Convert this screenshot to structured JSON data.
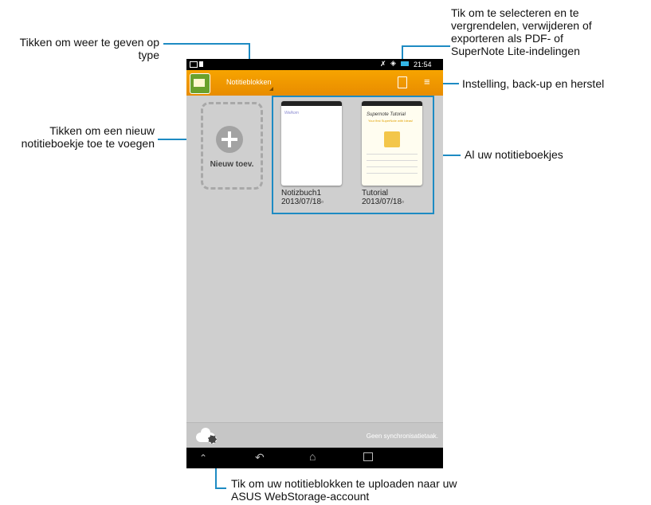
{
  "callouts": {
    "type_toggle": "Tikken om weer te geven op type",
    "select_lock": "Tik om te selecteren en te vergrendelen, verwijderen of exporteren als PDF- of SuperNote Lite-indelingen",
    "settings": "Instelling, back-up en herstel",
    "add_notebook": "Tikken om een nieuw notitieboekje toe te voegen",
    "all_notebooks": "Al uw notitieboekjes",
    "upload": "Tik om uw notitieblokken te uploaden naar uw ASUS WebStorage-account"
  },
  "device": {
    "status_time": "21:54",
    "actionbar_title": "Notitieblokken",
    "add_label": "Nieuw toev.",
    "sync_status": "Geen synchronisatietaak.",
    "notebooks": [
      {
        "name": "Notizbuch1",
        "date": "2013/07/18",
        "thumb_text": "Welkom"
      },
      {
        "name": "Tutorial",
        "date": "2013/07/18",
        "thumb_title": "Supernote Tutorial",
        "thumb_subtitle": "Your first SuperNote with Ideas!"
      }
    ]
  },
  "colors": {
    "accent": "#1e8bc3",
    "actionbar": "#f29a00"
  }
}
